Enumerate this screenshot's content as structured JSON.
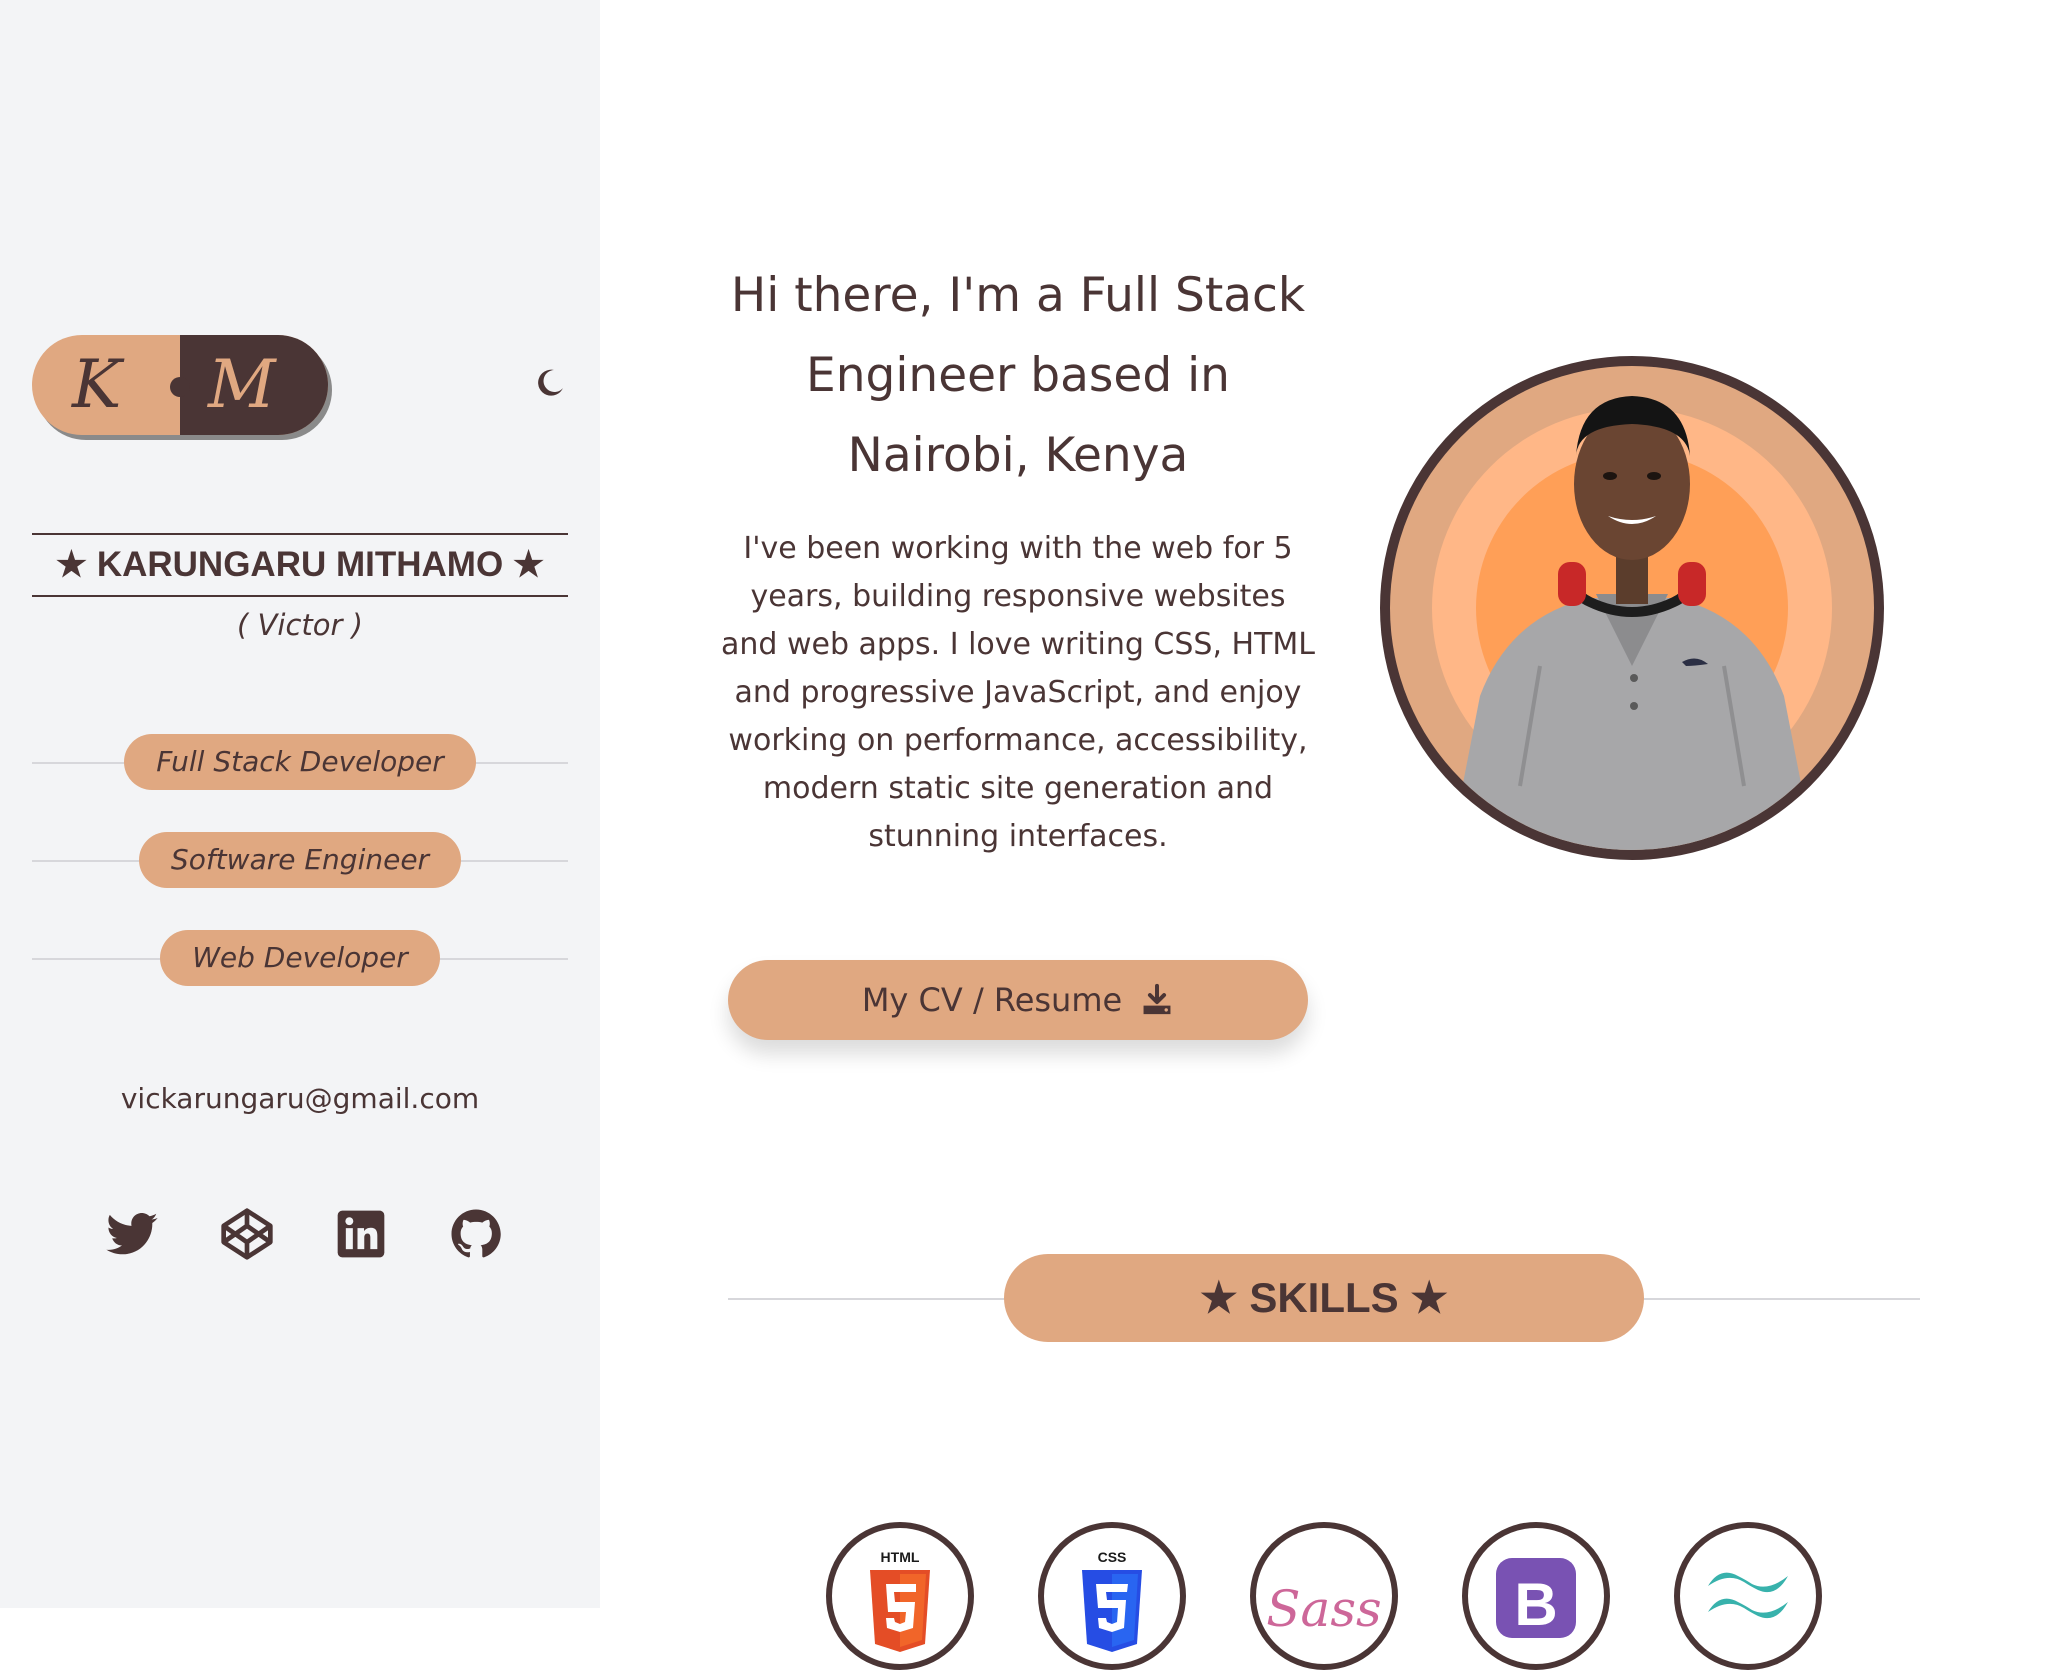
{
  "sidebar": {
    "logo": {
      "left_letter": "K",
      "right_letter": "M"
    },
    "theme_toggle_icon": "moon-icon",
    "name": "★ KARUNGARU MITHAMO ★",
    "nickname": "( Victor )",
    "roles": [
      "Full Stack Developer",
      "Software Engineer",
      "Web Developer"
    ],
    "email": "vickarungaru@gmail.com",
    "socials": [
      {
        "name": "twitter",
        "icon": "twitter-icon"
      },
      {
        "name": "codepen",
        "icon": "codepen-icon"
      },
      {
        "name": "linkedin",
        "icon": "linkedin-icon"
      },
      {
        "name": "github",
        "icon": "github-icon"
      }
    ]
  },
  "hero": {
    "title_lines": [
      "Hi there, I'm a Full Stack",
      "Engineer based in",
      "Nairobi, Kenya"
    ],
    "description": "I've been working with the web for 5 years, building responsive websites and web apps. I love writing CSS, HTML and progressive JavaScript, and enjoy working on performance, accessibility, modern static site generation and stunning interfaces.",
    "cv_button": "My CV / Resume",
    "cv_icon": "download-icon"
  },
  "skills": {
    "title": "★ SKILLS ★",
    "items": [
      {
        "name": "html5",
        "icon": "html5-icon",
        "label": "HTML"
      },
      {
        "name": "css3",
        "icon": "css3-icon",
        "label": "CSS"
      },
      {
        "name": "sass",
        "icon": "sass-icon",
        "label": "Sass"
      },
      {
        "name": "bootstrap",
        "icon": "bootstrap-icon",
        "label": "B"
      },
      {
        "name": "tailwind",
        "icon": "tailwind-icon"
      }
    ]
  },
  "colors": {
    "accent": "#e0a881",
    "text": "#4a3535",
    "sidebar_bg": "#f3f4f6",
    "page_bg": "#ffffff",
    "html_orange": "#e44d26",
    "css_blue": "#264de4",
    "sass_pink": "#cd6799",
    "bootstrap_purple": "#7952b3",
    "tailwind_teal": "#38b2ac"
  }
}
